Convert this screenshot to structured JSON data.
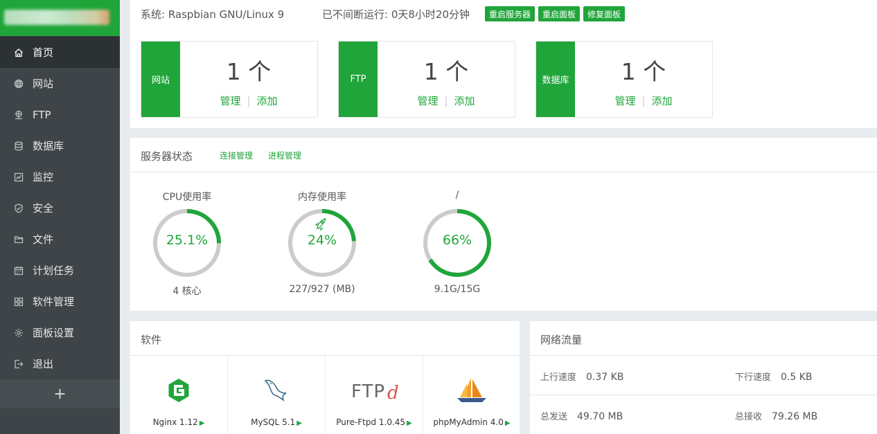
{
  "sidebar": {
    "items": [
      {
        "label": "首页",
        "icon": "home-icon"
      },
      {
        "label": "网站",
        "icon": "globe-icon"
      },
      {
        "label": "FTP",
        "icon": "ftp-icon"
      },
      {
        "label": "数据库",
        "icon": "database-icon"
      },
      {
        "label": "监控",
        "icon": "monitor-icon"
      },
      {
        "label": "安全",
        "icon": "shield-icon"
      },
      {
        "label": "文件",
        "icon": "folder-icon"
      },
      {
        "label": "计划任务",
        "icon": "calendar-icon"
      },
      {
        "label": "软件管理",
        "icon": "apps-icon"
      },
      {
        "label": "面板设置",
        "icon": "gear-icon"
      },
      {
        "label": "退出",
        "icon": "logout-icon"
      }
    ],
    "add_label": "+"
  },
  "header": {
    "system": "系统: Raspbian GNU/Linux 9",
    "uptime": "已不间断运行: 0天8小时20分钟",
    "buttons": [
      "重启服务器",
      "重启面板",
      "修复面板"
    ]
  },
  "overview": [
    {
      "tag": "网站",
      "count": "1 个",
      "manage": "管理",
      "add": "添加"
    },
    {
      "tag": "FTP",
      "count": "1 个",
      "manage": "管理",
      "add": "添加"
    },
    {
      "tag": "数据库",
      "count": "1 个",
      "manage": "管理",
      "add": "添加"
    }
  ],
  "status": {
    "title": "服务器状态",
    "links": [
      "连接管理",
      "进程管理"
    ],
    "gauges": [
      {
        "label": "CPU使用率",
        "value": "25.1%",
        "fraction": 0.251,
        "sub": "4 核心"
      },
      {
        "label": "内存使用率",
        "value": "24%",
        "fraction": 0.24,
        "sub": "227/927 (MB)",
        "icon": "rocket-icon"
      },
      {
        "label": "/",
        "value": "66%",
        "fraction": 0.66,
        "sub": "9.1G/15G"
      }
    ]
  },
  "software": {
    "title": "软件",
    "items": [
      {
        "name": "Nginx 1.12",
        "icon": "nginx-logo"
      },
      {
        "name": "MySQL 5.1",
        "icon": "mysql-logo"
      },
      {
        "name": "Pure-Ftpd 1.0.45",
        "icon": "ftpd-logo"
      },
      {
        "name": "phpMyAdmin 4.0",
        "icon": "phpmyadmin-logo"
      }
    ],
    "play": "▶"
  },
  "network": {
    "title": "网络流量",
    "up_label": "上行速度",
    "up_value": "0.37 KB",
    "down_label": "下行速度",
    "down_value": "0.5 KB",
    "sent_label": "总发送",
    "sent_value": "49.70 MB",
    "recv_label": "总接收",
    "recv_value": "79.26 MB"
  },
  "colors": {
    "accent": "#20a53a",
    "sidebar": "#3e4447",
    "track": "#cccccc"
  }
}
